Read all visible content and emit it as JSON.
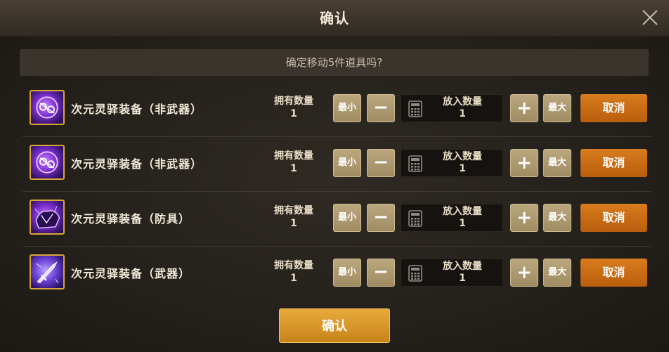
{
  "dialog": {
    "title": "确认",
    "prompt": "确定移动5件道具吗?",
    "confirm_label": "确认"
  },
  "labels": {
    "owned": "拥有数量",
    "put_in": "放入数量",
    "min": "最小",
    "max": "最大",
    "minus": "−",
    "plus": "+",
    "cancel": "取消"
  },
  "items": [
    {
      "name": "次元灵驿装备（非武器）",
      "owned": "1",
      "quantity": "1",
      "icon": "dimension-orb-icon"
    },
    {
      "name": "次元灵驿装备（非武器）",
      "owned": "1",
      "quantity": "1",
      "icon": "dimension-orb-icon"
    },
    {
      "name": "次元灵驿装备（防具）",
      "owned": "1",
      "quantity": "1",
      "icon": "dimension-armor-icon"
    },
    {
      "name": "次元灵驿装备（武器）",
      "owned": "1",
      "quantity": "1",
      "icon": "dimension-weapon-icon"
    }
  ],
  "colors": {
    "accent": "#c8831b",
    "cancel": "#b95e0c",
    "tan_button": "#a08c63",
    "icon_border": "#d9a63a"
  }
}
